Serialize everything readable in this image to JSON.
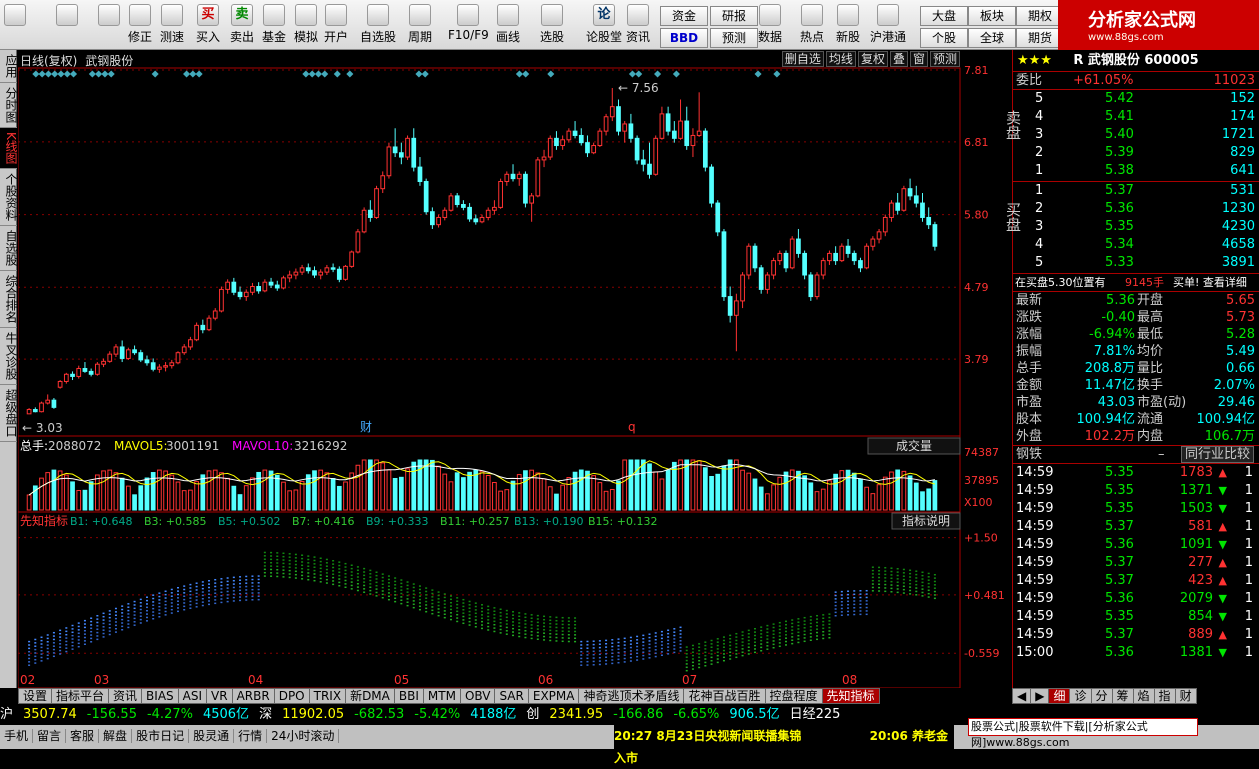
{
  "toolbar": {
    "buttons": [
      {
        "icon": "grid-icon",
        "label": ""
      },
      {
        "icon": "back-arrow-icon",
        "label": ""
      },
      {
        "icon": "up-down-arrow-icon",
        "label": ""
      },
      {
        "icon": "fix-icon",
        "label": "修正"
      },
      {
        "icon": "clock-icon",
        "label": "测速"
      },
      {
        "icon": "buy-icon",
        "label": "买入",
        "glyph": "买"
      },
      {
        "icon": "sell-icon",
        "label": "卖出",
        "glyph": "卖"
      },
      {
        "icon": "fund-icon",
        "label": "基金"
      },
      {
        "icon": "hammer-icon",
        "label": "模拟"
      },
      {
        "icon": "lock-icon",
        "label": "开户"
      },
      {
        "icon": "star-icon",
        "label": "自选股"
      },
      {
        "icon": "period-icon",
        "label": "周期"
      },
      {
        "icon": "f10-icon",
        "label": "F10/F9"
      },
      {
        "icon": "pen-icon",
        "label": "画线"
      },
      {
        "icon": "select-icon",
        "label": "选股"
      },
      {
        "icon": "lun-icon",
        "label": "论股堂",
        "glyph": "论"
      },
      {
        "icon": "info-icon",
        "label": "资讯"
      },
      {
        "icon": "pe-icon",
        "label": "数据"
      },
      {
        "icon": "hot-icon",
        "label": "热点"
      },
      {
        "icon": "new-icon",
        "label": "新股"
      },
      {
        "icon": "hk-icon",
        "label": "沪港通"
      }
    ],
    "small_buttons": [
      "资金",
      "研报",
      "BBD",
      "预测",
      "大盘",
      "板块",
      "期权",
      "个股",
      "全球",
      "期货"
    ]
  },
  "logo": {
    "title": "分析家公式网",
    "url": "www.88gs.com"
  },
  "sidebar": [
    "应用",
    "分时图",
    "K线图",
    "个股资料",
    "自选股",
    "综合排名",
    "牛叉诊股",
    "超级盘口"
  ],
  "chart_header": {
    "title": "日线(复权)",
    "name": "武钢股份",
    "tools": [
      "删自选",
      "均线",
      "复权",
      "叠",
      "窗",
      "预测"
    ]
  },
  "chart_data": [
    {
      "type": "candlestick",
      "title": "日线(复权) 武钢股份",
      "yticks": [
        7.81,
        6.81,
        5.8,
        4.79,
        3.79
      ],
      "ylim": [
        3.0,
        7.81
      ],
      "xlabels": [
        "02",
        "03",
        "04",
        "05",
        "06",
        "07",
        "08"
      ],
      "annotations": [
        {
          "text": "7.56",
          "kind": "max"
        },
        {
          "text": "3.03",
          "kind": "min"
        },
        {
          "text": "财",
          "kind": "marker"
        },
        {
          "text": "q",
          "kind": "marker"
        }
      ],
      "ohlc": [
        [
          3.03,
          3.11,
          3.03,
          3.09
        ],
        [
          3.09,
          3.12,
          3.05,
          3.06
        ],
        [
          3.06,
          3.2,
          3.05,
          3.18
        ],
        [
          3.18,
          3.3,
          3.16,
          3.22
        ],
        [
          3.22,
          3.25,
          3.1,
          3.12
        ],
        [
          3.4,
          3.5,
          3.38,
          3.48
        ],
        [
          3.48,
          3.6,
          3.45,
          3.58
        ],
        [
          3.58,
          3.62,
          3.5,
          3.55
        ],
        [
          3.55,
          3.7,
          3.52,
          3.66
        ],
        [
          3.66,
          3.75,
          3.6,
          3.62
        ],
        [
          3.62,
          3.66,
          3.55,
          3.58
        ],
        [
          3.58,
          3.75,
          3.56,
          3.72
        ],
        [
          3.72,
          3.8,
          3.68,
          3.76
        ],
        [
          3.76,
          3.9,
          3.74,
          3.86
        ],
        [
          3.86,
          4.0,
          3.82,
          3.96
        ],
        [
          3.96,
          4.05,
          3.75,
          3.8
        ],
        [
          3.8,
          3.95,
          3.78,
          3.92
        ],
        [
          3.92,
          3.98,
          3.85,
          3.88
        ],
        [
          3.88,
          3.92,
          3.75,
          3.78
        ],
        [
          3.78,
          3.84,
          3.7,
          3.74
        ],
        [
          3.74,
          3.8,
          3.62,
          3.65
        ],
        [
          3.65,
          3.72,
          3.6,
          3.68
        ],
        [
          3.68,
          3.75,
          3.62,
          3.7
        ],
        [
          3.7,
          3.78,
          3.66,
          3.74
        ],
        [
          3.74,
          3.9,
          3.72,
          3.88
        ],
        [
          3.88,
          4.0,
          3.85,
          3.96
        ],
        [
          3.96,
          4.1,
          3.92,
          4.06
        ],
        [
          4.06,
          4.3,
          4.04,
          4.26
        ],
        [
          4.26,
          4.34,
          4.15,
          4.2
        ],
        [
          4.2,
          4.4,
          4.18,
          4.36
        ],
        [
          4.36,
          4.5,
          4.33,
          4.46
        ],
        [
          4.46,
          4.8,
          4.44,
          4.76
        ],
        [
          4.76,
          4.9,
          4.7,
          4.86
        ],
        [
          4.86,
          4.92,
          4.68,
          4.72
        ],
        [
          4.72,
          4.8,
          4.62,
          4.66
        ],
        [
          4.66,
          4.76,
          4.6,
          4.72
        ],
        [
          4.72,
          4.85,
          4.68,
          4.8
        ],
        [
          4.8,
          4.86,
          4.7,
          4.74
        ],
        [
          4.74,
          4.9,
          4.72,
          4.86
        ],
        [
          4.86,
          4.92,
          4.78,
          4.82
        ],
        [
          4.82,
          4.88,
          4.74,
          4.78
        ],
        [
          4.78,
          4.95,
          4.76,
          4.92
        ],
        [
          4.92,
          5.02,
          4.86,
          4.96
        ],
        [
          4.96,
          5.05,
          4.9,
          5.0
        ],
        [
          5.0,
          5.1,
          4.96,
          5.06
        ],
        [
          5.06,
          5.12,
          4.98,
          5.02
        ],
        [
          5.02,
          5.08,
          4.92,
          4.96
        ],
        [
          4.96,
          5.04,
          4.9,
          5.0
        ],
        [
          5.0,
          5.1,
          4.96,
          5.06
        ],
        [
          5.06,
          5.12,
          5.0,
          5.04
        ],
        [
          5.04,
          5.08,
          4.86,
          4.9
        ],
        [
          4.9,
          5.1,
          4.88,
          5.08
        ],
        [
          5.08,
          5.3,
          5.06,
          5.28
        ],
        [
          5.28,
          5.6,
          5.26,
          5.56
        ],
        [
          5.56,
          5.9,
          5.54,
          5.86
        ],
        [
          5.86,
          6.0,
          5.7,
          5.76
        ],
        [
          5.76,
          6.2,
          5.74,
          6.16
        ],
        [
          6.16,
          6.4,
          6.1,
          6.34
        ],
        [
          6.34,
          6.8,
          6.3,
          6.74
        ],
        [
          6.74,
          7.0,
          6.6,
          6.66
        ],
        [
          6.66,
          6.8,
          6.5,
          6.6
        ],
        [
          6.6,
          6.9,
          6.56,
          6.86
        ],
        [
          6.86,
          7.0,
          6.4,
          6.46
        ],
        [
          6.46,
          6.6,
          6.2,
          6.26
        ],
        [
          6.26,
          6.3,
          5.8,
          5.84
        ],
        [
          5.84,
          5.9,
          5.6,
          5.66
        ],
        [
          5.66,
          5.8,
          5.62,
          5.76
        ],
        [
          5.76,
          5.9,
          5.72,
          5.86
        ],
        [
          5.86,
          6.1,
          5.84,
          6.06
        ],
        [
          6.06,
          6.1,
          5.9,
          5.94
        ],
        [
          5.94,
          6.0,
          5.86,
          5.9
        ],
        [
          5.9,
          5.96,
          5.7,
          5.74
        ],
        [
          5.74,
          5.8,
          5.66,
          5.7
        ],
        [
          5.7,
          5.8,
          5.68,
          5.76
        ],
        [
          5.76,
          5.9,
          5.72,
          5.86
        ],
        [
          5.86,
          6.0,
          5.8,
          5.9
        ],
        [
          5.9,
          6.3,
          5.88,
          6.26
        ],
        [
          6.26,
          6.4,
          6.2,
          6.36
        ],
        [
          6.36,
          6.5,
          6.26,
          6.3
        ],
        [
          6.3,
          6.4,
          6.2,
          6.36
        ],
        [
          6.36,
          6.4,
          5.9,
          5.96
        ],
        [
          5.96,
          6.1,
          5.7,
          6.06
        ],
        [
          6.06,
          6.6,
          6.04,
          6.56
        ],
        [
          6.56,
          6.7,
          6.46,
          6.6
        ],
        [
          6.6,
          6.9,
          6.56,
          6.86
        ],
        [
          6.86,
          6.96,
          6.7,
          6.76
        ],
        [
          6.76,
          6.9,
          6.7,
          6.84
        ],
        [
          6.84,
          7.0,
          6.8,
          6.96
        ],
        [
          6.96,
          7.1,
          6.86,
          6.9
        ],
        [
          6.9,
          7.0,
          6.76,
          6.8
        ],
        [
          6.8,
          6.9,
          6.6,
          6.66
        ],
        [
          6.66,
          6.8,
          6.64,
          6.76
        ],
        [
          6.76,
          7.0,
          6.74,
          6.96
        ],
        [
          6.96,
          7.2,
          6.9,
          7.16
        ],
        [
          7.16,
          7.56,
          7.1,
          7.3
        ],
        [
          7.3,
          7.4,
          6.9,
          6.96
        ],
        [
          6.96,
          7.1,
          6.8,
          7.06
        ],
        [
          7.06,
          7.2,
          6.8,
          6.86
        ],
        [
          6.86,
          6.9,
          6.5,
          6.56
        ],
        [
          6.56,
          6.7,
          6.4,
          6.5
        ],
        [
          6.5,
          6.8,
          6.3,
          6.36
        ],
        [
          6.36,
          6.9,
          6.34,
          6.86
        ],
        [
          6.86,
          7.3,
          6.84,
          7.2
        ],
        [
          7.2,
          7.3,
          6.9,
          6.96
        ],
        [
          6.96,
          7.1,
          6.8,
          6.86
        ],
        [
          6.86,
          7.4,
          6.84,
          7.1
        ],
        [
          7.1,
          7.3,
          6.7,
          6.76
        ],
        [
          6.76,
          7.0,
          6.6,
          6.9
        ],
        [
          6.9,
          7.5,
          6.88,
          6.96
        ],
        [
          6.96,
          7.0,
          6.4,
          6.46
        ],
        [
          6.46,
          6.5,
          5.9,
          5.96
        ],
        [
          5.96,
          6.0,
          5.5,
          5.56
        ],
        [
          5.56,
          5.6,
          4.6,
          4.66
        ],
        [
          4.66,
          4.8,
          4.3,
          4.4
        ],
        [
          4.4,
          4.7,
          3.9,
          4.6
        ],
        [
          4.6,
          5.0,
          4.5,
          4.96
        ],
        [
          4.96,
          5.4,
          4.9,
          5.36
        ],
        [
          5.36,
          5.4,
          5.0,
          5.06
        ],
        [
          5.06,
          5.1,
          4.7,
          4.76
        ],
        [
          4.76,
          5.0,
          4.7,
          4.96
        ],
        [
          4.96,
          5.2,
          4.9,
          5.16
        ],
        [
          5.16,
          5.3,
          5.1,
          5.26
        ],
        [
          5.26,
          5.3,
          5.0,
          5.06
        ],
        [
          5.06,
          5.5,
          5.04,
          5.46
        ],
        [
          5.46,
          5.6,
          5.2,
          5.26
        ],
        [
          5.26,
          5.3,
          4.9,
          4.96
        ],
        [
          4.96,
          5.0,
          4.6,
          4.66
        ],
        [
          4.66,
          5.0,
          4.62,
          4.96
        ],
        [
          4.96,
          5.2,
          4.9,
          5.16
        ],
        [
          5.16,
          5.3,
          5.1,
          5.26
        ],
        [
          5.26,
          5.36,
          5.1,
          5.16
        ],
        [
          5.16,
          5.4,
          5.14,
          5.36
        ],
        [
          5.36,
          5.46,
          5.2,
          5.26
        ],
        [
          5.26,
          5.3,
          5.1,
          5.16
        ],
        [
          5.16,
          5.2,
          5.0,
          5.06
        ],
        [
          5.06,
          5.4,
          5.04,
          5.36
        ],
        [
          5.36,
          5.5,
          5.3,
          5.46
        ],
        [
          5.46,
          5.6,
          5.4,
          5.56
        ],
        [
          5.56,
          5.8,
          5.5,
          5.76
        ],
        [
          5.76,
          6.0,
          5.7,
          5.96
        ],
        [
          5.96,
          6.1,
          5.8,
          5.86
        ],
        [
          5.86,
          6.2,
          5.84,
          6.16
        ],
        [
          6.16,
          6.3,
          6.0,
          6.06
        ],
        [
          6.06,
          6.2,
          5.9,
          5.96
        ],
        [
          5.96,
          6.1,
          5.7,
          5.76
        ],
        [
          5.76,
          5.9,
          5.6,
          5.66
        ],
        [
          5.66,
          5.7,
          5.3,
          5.36
        ]
      ]
    },
    {
      "type": "bar",
      "title": "总手",
      "series_labels": [
        {
          "name": "总手",
          "value": "2088072",
          "dir": "down"
        },
        {
          "name": "MAVOL5",
          "value": "3001191",
          "dir": "down"
        },
        {
          "name": "MAVOL10",
          "value": "3216292",
          "dir": "up"
        }
      ],
      "yticks": [
        "74387",
        "37895",
        "X100"
      ],
      "selector": "成交量",
      "ylim": [
        0,
        74387
      ]
    },
    {
      "type": "scatter",
      "title": "先知指标",
      "series_labels": [
        "B1: +0.648",
        "B3: +0.585",
        "B5: +0.502",
        "B7: +0.416",
        "B9: +0.333",
        "B11: +0.257",
        "B13: +0.190",
        "B15: +0.132"
      ],
      "yticks": [
        "+1.50",
        "+0.481",
        "-0.559"
      ],
      "ylim": [
        -1.0,
        1.6
      ],
      "button": "指标说明"
    }
  ],
  "quote": {
    "stars": "★★★",
    "stock": "R 武钢股份 600005",
    "weibi_label": "委比",
    "weibi": "+61.05%",
    "weicha": "11023",
    "sell_label": "卖盘",
    "buy_label": "买盘",
    "sell": [
      [
        "5",
        "5.42",
        "152"
      ],
      [
        "4",
        "5.41",
        "174"
      ],
      [
        "3",
        "5.40",
        "1721"
      ],
      [
        "2",
        "5.39",
        "829"
      ],
      [
        "1",
        "5.38",
        "641"
      ]
    ],
    "buy": [
      [
        "1",
        "5.37",
        "531"
      ],
      [
        "2",
        "5.36",
        "1230"
      ],
      [
        "3",
        "5.35",
        "4230"
      ],
      [
        "4",
        "5.34",
        "4658"
      ],
      [
        "5",
        "5.33",
        "3891"
      ]
    ],
    "notice": {
      "text": "在买盘5.30位置有",
      "qty": "9145手",
      "action": "买单! 查看详细"
    },
    "stats": [
      [
        "最新",
        "5.36",
        "开盘",
        "5.65"
      ],
      [
        "涨跌",
        "-0.40",
        "最高",
        "5.73"
      ],
      [
        "涨幅",
        "-6.94%",
        "最低",
        "5.28"
      ],
      [
        "振幅",
        "7.81%",
        "均价",
        "5.49"
      ],
      [
        "总手",
        "208.8万",
        "量比",
        "0.66"
      ],
      [
        "金额",
        "11.47亿",
        "换手",
        "2.07%"
      ],
      [
        "市盈",
        "43.03",
        "市盈(动)",
        "29.46"
      ],
      [
        "股本",
        "100.94亿",
        "流通",
        "100.94亿"
      ],
      [
        "外盘",
        "102.2万",
        "内盘",
        "106.7万"
      ]
    ],
    "industry": {
      "name": "钢铁",
      "dash": "–",
      "compare": "同行业比较"
    },
    "ticks": [
      [
        "14:59",
        "5.35",
        "1783",
        "up"
      ],
      [
        "14:59",
        "5.35",
        "1371",
        "down"
      ],
      [
        "14:59",
        "5.35",
        "1503",
        "down"
      ],
      [
        "14:59",
        "5.37",
        "581",
        "up"
      ],
      [
        "14:59",
        "5.36",
        "1091",
        "down"
      ],
      [
        "14:59",
        "5.37",
        "277",
        "up"
      ],
      [
        "14:59",
        "5.37",
        "423",
        "up"
      ],
      [
        "14:59",
        "5.36",
        "2079",
        "down"
      ],
      [
        "14:59",
        "5.35",
        "854",
        "down"
      ],
      [
        "14:59",
        "5.37",
        "889",
        "up"
      ],
      [
        "15:00",
        "5.36",
        "1381",
        "down"
      ]
    ],
    "tick_flags": [
      "1",
      "1",
      "1",
      "1",
      "1",
      "1",
      "1",
      "1",
      "1",
      "1",
      "1"
    ]
  },
  "bottom_tabs": [
    "设置",
    "指标平台",
    "资讯",
    "BIAS",
    "ASI",
    "VR",
    "ARBR",
    "DPO",
    "TRIX",
    "新DMA",
    "BBI",
    "MTM",
    "OBV",
    "SAR",
    "EXPMA",
    "神奇逃顶术矛盾线",
    "花神百战百胜",
    "控盘程度",
    "先知指标"
  ],
  "side_tabs": [
    "◀",
    "▶",
    "细",
    "诊",
    "分",
    "筹",
    "焰",
    "指",
    "财"
  ],
  "index_bar": [
    "沪",
    "3507.74",
    "-156.55",
    "-4.27%",
    "4506亿",
    "深",
    "11902.05",
    "-682.53",
    "-5.42%",
    "4188亿",
    "创",
    "2341.95",
    "-166.86",
    "-6.65%",
    "906.5亿",
    "日经225"
  ],
  "status_bar": [
    "手机",
    "留言",
    "客服",
    "解盘",
    "股市日记",
    "股灵通",
    "行情",
    "24小时滚动"
  ],
  "news": {
    "left": "20:27 8月23日央视新闻联播集锦",
    "right": "20:06 养老金入市"
  },
  "advert": "股票公式|股票软件下载|[分析家公式网]www.88gs.com"
}
